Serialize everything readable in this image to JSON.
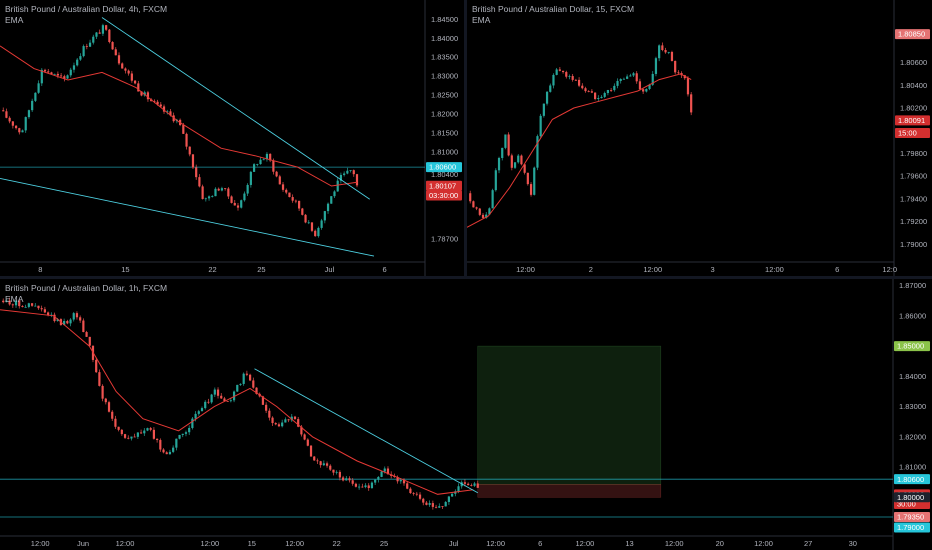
{
  "panes": [
    {
      "id": "tl",
      "title": "British Pound / Australian Dollar, 4h, FXCM",
      "indicator": "EMA",
      "chart_data": {
        "type": "candlestick",
        "ylim": [
          1.782,
          1.848
        ],
        "y_ticks": [
          "1.84500",
          "1.84000",
          "1.83500",
          "1.83000",
          "1.82500",
          "1.82000",
          "1.81500",
          "1.81000",
          "1.80400",
          "1.79920",
          "1.78700"
        ],
        "y_tick_values": [
          1.845,
          1.84,
          1.835,
          1.83,
          1.825,
          1.82,
          1.815,
          1.81,
          1.804,
          1.7992,
          1.787
        ],
        "x_ticks": [
          "8",
          "15",
          "22",
          "25",
          "Jul",
          "6"
        ],
        "x_tick_frac": [
          0.095,
          0.295,
          0.5,
          0.615,
          0.775,
          0.905
        ],
        "close_path": [
          [
            0,
            1.821
          ],
          [
            0.05,
            1.815
          ],
          [
            0.1,
            1.832
          ],
          [
            0.15,
            1.829
          ],
          [
            0.2,
            1.838
          ],
          [
            0.245,
            1.843
          ],
          [
            0.28,
            1.834
          ],
          [
            0.33,
            1.826
          ],
          [
            0.37,
            1.822
          ],
          [
            0.42,
            1.818
          ],
          [
            0.45,
            1.808
          ],
          [
            0.48,
            1.797
          ],
          [
            0.52,
            1.801
          ],
          [
            0.56,
            1.795
          ],
          [
            0.6,
            1.807
          ],
          [
            0.63,
            1.809
          ],
          [
            0.66,
            1.801
          ],
          [
            0.7,
            1.796
          ],
          [
            0.74,
            1.788
          ],
          [
            0.77,
            1.796
          ],
          [
            0.8,
            1.803
          ],
          [
            0.83,
            1.8055
          ],
          [
            0.84,
            1.8011
          ]
        ],
        "ema_path": [
          [
            0,
            1.838
          ],
          [
            0.08,
            1.832
          ],
          [
            0.16,
            1.829
          ],
          [
            0.24,
            1.831
          ],
          [
            0.32,
            1.827
          ],
          [
            0.42,
            1.818
          ],
          [
            0.52,
            1.811
          ],
          [
            0.6,
            1.809
          ],
          [
            0.7,
            1.806
          ],
          [
            0.78,
            1.801
          ],
          [
            0.84,
            1.802
          ]
        ],
        "trendlines": [
          [
            [
              0.24,
              1.8455
            ],
            [
              0.87,
              1.7975
            ]
          ],
          [
            [
              0,
              1.803
            ],
            [
              0.88,
              1.7825
            ]
          ]
        ],
        "hlines": [
          1.806
        ],
        "price_tags": [
          {
            "label": "1.80600",
            "value": 1.806,
            "color": "#26c6da"
          },
          {
            "label": "1.80107",
            "value": 1.80107,
            "color": "#d32f2f"
          },
          {
            "label": "03:30:00",
            "value": 1.7985,
            "color": "#d32f2f"
          }
        ]
      }
    },
    {
      "id": "tr",
      "title": "British Pound / Australian Dollar, 15, FXCM",
      "indicator": "EMA",
      "chart_data": {
        "type": "candlestick",
        "ylim": [
          1.7888,
          1.8108
        ],
        "y_ticks": [
          "1.80850",
          "1.80600",
          "1.80400",
          "1.80200",
          "1.80000",
          "1.79800",
          "1.79600",
          "1.79400",
          "1.79200",
          "1.79000"
        ],
        "y_tick_values": [
          1.8085,
          1.806,
          1.804,
          1.802,
          1.8,
          1.798,
          1.796,
          1.794,
          1.792,
          1.79
        ],
        "x_ticks": [
          "12:00",
          "2",
          "12:00",
          "3",
          "12:00",
          "6",
          "12:0"
        ],
        "x_tick_frac": [
          0.137,
          0.29,
          0.435,
          0.575,
          0.72,
          0.867,
          0.99
        ],
        "close_path": [
          [
            0,
            1.7945
          ],
          [
            0.03,
            1.7925
          ],
          [
            0.05,
            1.7925
          ],
          [
            0.07,
            1.797
          ],
          [
            0.09,
            1.7995
          ],
          [
            0.105,
            1.7965
          ],
          [
            0.12,
            1.798
          ],
          [
            0.14,
            1.7955
          ],
          [
            0.15,
            1.7945
          ],
          [
            0.17,
            1.801
          ],
          [
            0.19,
            1.8035
          ],
          [
            0.21,
            1.8055
          ],
          [
            0.23,
            1.805
          ],
          [
            0.25,
            1.8045
          ],
          [
            0.28,
            1.8035
          ],
          [
            0.3,
            1.803
          ],
          [
            0.33,
            1.8035
          ],
          [
            0.36,
            1.8045
          ],
          [
            0.39,
            1.805
          ],
          [
            0.41,
            1.8035
          ],
          [
            0.43,
            1.804
          ],
          [
            0.45,
            1.8075
          ],
          [
            0.47,
            1.807
          ],
          [
            0.49,
            1.805
          ],
          [
            0.51,
            1.8045
          ],
          [
            0.525,
            1.8015
          ]
        ],
        "ema_path": [
          [
            0,
            1.7915
          ],
          [
            0.05,
            1.7925
          ],
          [
            0.1,
            1.795
          ],
          [
            0.15,
            1.798
          ],
          [
            0.2,
            1.801
          ],
          [
            0.25,
            1.802
          ],
          [
            0.3,
            1.8025
          ],
          [
            0.35,
            1.803
          ],
          [
            0.4,
            1.8035
          ],
          [
            0.45,
            1.8045
          ],
          [
            0.5,
            1.805
          ],
          [
            0.525,
            1.8045
          ]
        ],
        "trendlines": [],
        "hlines": [],
        "price_tags": [
          {
            "label": "1.80850",
            "value": 1.8085,
            "color": "#e57373"
          },
          {
            "label": "1.80091",
            "value": 1.80091,
            "color": "#d32f2f"
          },
          {
            "label": "15:00",
            "value": 1.7998,
            "color": "#d32f2f"
          }
        ]
      }
    },
    {
      "id": "b",
      "title": "British Pound / Australian Dollar, 1h, FXCM",
      "indicator": "EMA",
      "chart_data": {
        "type": "candlestick",
        "ylim": [
          1.7882,
          1.8702
        ],
        "y_ticks": [
          "1.87000",
          "1.86000",
          "1.85000",
          "1.84000",
          "1.83000",
          "1.82000",
          "1.81000",
          "1.80600",
          "1.80096",
          "1.80000",
          "1.79350",
          "1.79000"
        ],
        "y_tick_values": [
          1.87,
          1.86,
          1.85,
          1.84,
          1.83,
          1.82,
          1.81,
          1.806,
          1.80096,
          1.8,
          1.7935,
          1.79
        ],
        "x_ticks": [
          "12:00",
          "Jun",
          "12:00",
          "12:00",
          "15",
          "12:00",
          "22",
          "25",
          "Jul",
          "12:00",
          "6",
          "12:00",
          "13",
          "12:00",
          "20",
          "12:00",
          "27",
          "30"
        ],
        "x_tick_frac": [
          0.045,
          0.093,
          0.14,
          0.235,
          0.282,
          0.33,
          0.377,
          0.43,
          0.508,
          0.555,
          0.605,
          0.655,
          0.705,
          0.755,
          0.806,
          0.855,
          0.905,
          0.955
        ],
        "close_path": [
          [
            0,
            1.865
          ],
          [
            0.04,
            1.863
          ],
          [
            0.07,
            1.857
          ],
          [
            0.085,
            1.861
          ],
          [
            0.1,
            1.851
          ],
          [
            0.115,
            1.833
          ],
          [
            0.13,
            1.823
          ],
          [
            0.145,
            1.819
          ],
          [
            0.165,
            1.823
          ],
          [
            0.185,
            1.814
          ],
          [
            0.205,
            1.821
          ],
          [
            0.225,
            1.829
          ],
          [
            0.24,
            1.835
          ],
          [
            0.255,
            1.831
          ],
          [
            0.275,
            1.841
          ],
          [
            0.29,
            1.833
          ],
          [
            0.31,
            1.823
          ],
          [
            0.33,
            1.827
          ],
          [
            0.35,
            1.813
          ],
          [
            0.37,
            1.809
          ],
          [
            0.39,
            1.805
          ],
          [
            0.41,
            1.803
          ],
          [
            0.43,
            1.809
          ],
          [
            0.45,
            1.805
          ],
          [
            0.47,
            1.799
          ],
          [
            0.49,
            1.796
          ],
          [
            0.505,
            1.801
          ],
          [
            0.52,
            1.8055
          ],
          [
            0.535,
            1.8035
          ]
        ],
        "ema_path": [
          [
            0,
            1.862
          ],
          [
            0.06,
            1.86
          ],
          [
            0.1,
            1.85
          ],
          [
            0.13,
            1.835
          ],
          [
            0.16,
            1.826
          ],
          [
            0.2,
            1.822
          ],
          [
            0.24,
            1.83
          ],
          [
            0.28,
            1.836
          ],
          [
            0.31,
            1.83
          ],
          [
            0.35,
            1.82
          ],
          [
            0.4,
            1.812
          ],
          [
            0.45,
            1.806
          ],
          [
            0.49,
            1.801
          ],
          [
            0.53,
            1.8025
          ]
        ],
        "trendlines": [
          [
            [
              0.285,
              1.8425
            ],
            [
              0.535,
              1.8015
            ]
          ]
        ],
        "hlines": [
          1.806,
          1.7935
        ],
        "box_long": {
          "x0": 0.535,
          "x1": 0.74,
          "entry": 1.8043,
          "target": 1.85
        },
        "box_short": {
          "x0": 0.535,
          "x1": 0.74,
          "entry": 1.8043,
          "stop": 1.8
        },
        "price_tags": [
          {
            "label": "1.85000",
            "value": 1.85,
            "color": "#8bc34a"
          },
          {
            "label": "1.80600",
            "value": 1.806,
            "color": "#26c6da"
          },
          {
            "label": "1.80096",
            "value": 1.80096,
            "color": "#d32f2f"
          },
          {
            "label": "30:00",
            "value": 1.7978,
            "color": "#d32f2f"
          },
          {
            "label": "1.80000",
            "value": 1.8,
            "color": "#1e222d"
          },
          {
            "label": "1.79350",
            "value": 1.7935,
            "color": "#e57373"
          },
          {
            "label": "1.79000",
            "value": 1.79,
            "color": "#26c6da"
          }
        ]
      }
    }
  ],
  "colors": {
    "up": "#26a69a",
    "down": "#ef5350",
    "ema": "#e53935",
    "trend": "#4dd0e1",
    "hline": "#26c6da"
  }
}
